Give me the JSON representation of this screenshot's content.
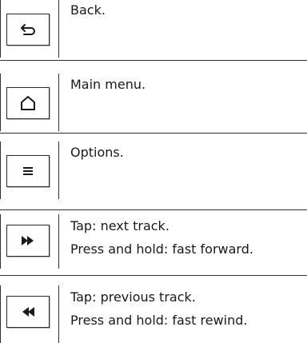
{
  "buttons": [
    {
      "icon": "back-arrow-icon",
      "lines": [
        "Back."
      ]
    },
    {
      "icon": "home-icon",
      "lines": [
        "Main menu."
      ]
    },
    {
      "icon": "menu-lines-icon",
      "lines": [
        "Options."
      ]
    },
    {
      "icon": "fast-forward-icon",
      "lines": [
        "Tap: next track.",
        "Press and hold: fast forward."
      ]
    },
    {
      "icon": "rewind-icon",
      "lines": [
        "Tap: previous track.",
        "Press and hold: fast rewind."
      ]
    }
  ]
}
